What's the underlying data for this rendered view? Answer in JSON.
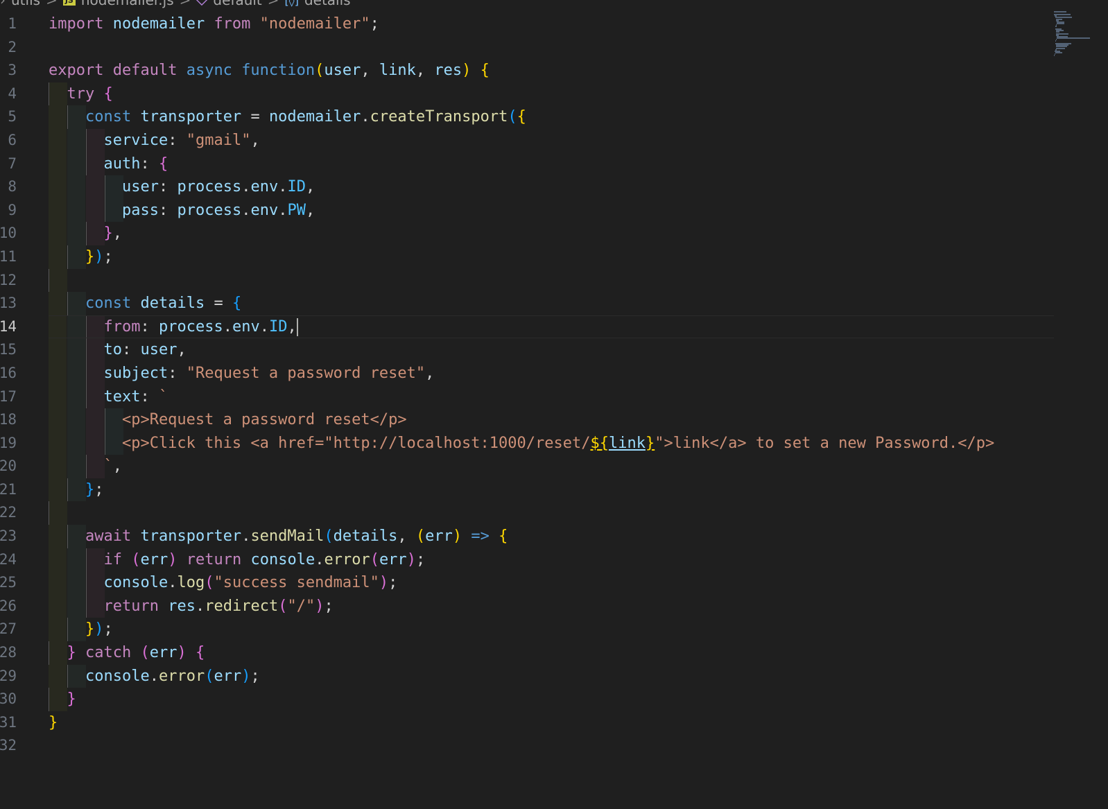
{
  "breadcrumb": {
    "items": [
      {
        "label": "utils",
        "icon": "folder"
      },
      {
        "label": "nodemailer.js",
        "icon": "js-file-icon",
        "badge": "JS"
      },
      {
        "label": "default",
        "icon": "symbol-method-icon"
      },
      {
        "label": "details",
        "icon": "symbol-variable-icon"
      }
    ],
    "separator": ">"
  },
  "editor": {
    "file": "nodemailer.js",
    "cursor_line": 14,
    "line_numbers": [
      "1",
      "2",
      "3",
      "4",
      "5",
      "6",
      "7",
      "8",
      "9",
      "10",
      "11",
      "12",
      "13",
      "14",
      "15",
      "16",
      "17",
      "18",
      "19",
      "20",
      "21",
      "22",
      "23",
      "24",
      "25",
      "26",
      "27",
      "28",
      "29",
      "30",
      "31",
      "32"
    ],
    "lines": [
      "import nodemailer from \"nodemailer\";",
      "",
      "export default async function(user, link, res) {",
      "  try {",
      "    const transporter = nodemailer.createTransport({",
      "      service: \"gmail\",",
      "      auth: {",
      "        user: process.env.ID,",
      "        pass: process.env.PW,",
      "      },",
      "    });",
      "",
      "    const details = {",
      "      from: process.env.ID,",
      "      to: user,",
      "      subject: \"Request a password reset\",",
      "      text: `",
      "        <p>Request a password reset</p>",
      "        <p>Click this <a href=\"http://localhost:1000/reset/${link}\">link</a> to set a new Password.</p>",
      "      `,",
      "    };",
      "",
      "    await transporter.sendMail(details, (err) => {",
      "      if (err) return console.error(err);",
      "      console.log(\"success sendmail\");",
      "      return res.redirect(\"/\");",
      "    });",
      "  } catch (err) {",
      "    console.error(err);",
      "  }",
      "}",
      ""
    ]
  },
  "colors": {
    "background": "#1f1f1f",
    "keyword": "#c586c0",
    "storage": "#569cd6",
    "function": "#dcdcaa",
    "variable": "#9cdcfe",
    "constant": "#4fc1ff",
    "string": "#ce9178",
    "bracket1": "#ffd700",
    "bracket2": "#da70d6",
    "bracket3": "#179fff"
  }
}
